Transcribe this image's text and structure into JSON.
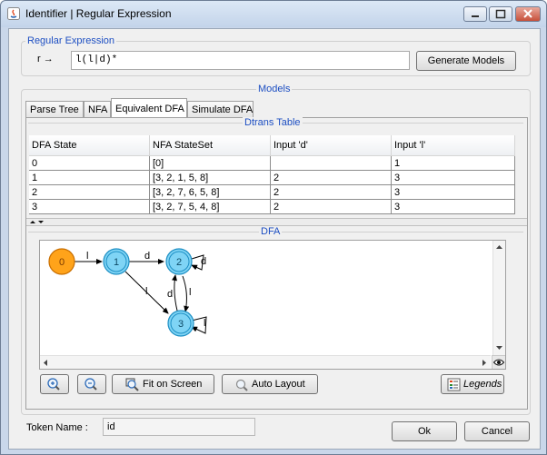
{
  "window": {
    "title": "Identifier | Regular Expression"
  },
  "regex": {
    "legend": "Regular Expression",
    "prefix": "r →",
    "value": "l(l|d)*",
    "generate_label": "Generate Models"
  },
  "models": {
    "legend": "Models",
    "tabs": [
      {
        "label": "Parse Tree"
      },
      {
        "label": "NFA"
      },
      {
        "label": "Equivalent DFA"
      },
      {
        "label": "Simulate DFA"
      }
    ],
    "active_tab": "Equivalent DFA"
  },
  "dtrans": {
    "legend": "Dtrans Table",
    "columns": [
      "DFA State",
      "NFA StateSet",
      "Input 'd'",
      "Input 'l'"
    ],
    "rows": [
      [
        "0",
        "[0]",
        "",
        "1"
      ],
      [
        "1",
        "[3, 2, 1, 5, 8]",
        "2",
        "3"
      ],
      [
        "2",
        "[3, 2, 7, 6, 5, 8]",
        "2",
        "3"
      ],
      [
        "3",
        "[3, 2, 7, 5, 4, 8]",
        "2",
        "3"
      ]
    ]
  },
  "dfa": {
    "legend": "DFA",
    "states": [
      {
        "label": "0",
        "start": true,
        "accepting": false
      },
      {
        "label": "1",
        "start": false,
        "accepting": true
      },
      {
        "label": "2",
        "start": false,
        "accepting": true
      },
      {
        "label": "3",
        "start": false,
        "accepting": true
      }
    ],
    "edges": [
      {
        "from": "0",
        "to": "1",
        "label": "l"
      },
      {
        "from": "1",
        "to": "2",
        "label": "d"
      },
      {
        "from": "1",
        "to": "3",
        "label": "l"
      },
      {
        "from": "3",
        "to": "2",
        "label": "d"
      },
      {
        "from": "2",
        "to": "3",
        "label": "l"
      },
      {
        "from": "2",
        "to": "2",
        "label": "d"
      },
      {
        "from": "3",
        "to": "3",
        "label": "l"
      }
    ],
    "colors": {
      "start_fill": "#ffa31a",
      "start_stroke": "#c86e00",
      "accept_fill": "#7fd4f5",
      "accept_stroke": "#1d8fc4"
    },
    "buttons": {
      "fit": "Fit on Screen",
      "layout": "Auto Layout",
      "legends": "Legends"
    }
  },
  "token": {
    "label": "Token Name :",
    "value": "id"
  },
  "actions": {
    "ok": "Ok",
    "cancel": "Cancel"
  }
}
